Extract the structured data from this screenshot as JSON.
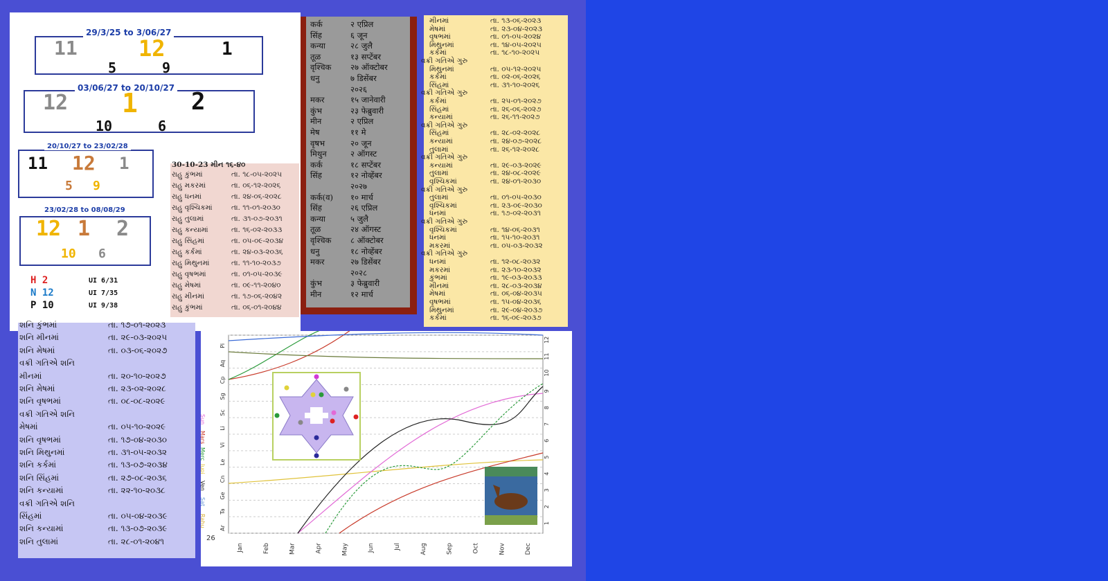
{
  "top_left": {
    "blocks": [
      {
        "caption": "29/3/25 to  3/06/27",
        "top": [
          "11",
          "12",
          "1"
        ],
        "bottom": [
          "5",
          "9"
        ]
      },
      {
        "caption": "03/06/27 to 20/10/27",
        "top": [
          "12",
          "1",
          "2"
        ],
        "bottom": [
          "10",
          "6"
        ]
      },
      {
        "caption": "20/10/27 to 23/02/28",
        "top": [
          "11",
          "12",
          "1"
        ],
        "bottom": [
          "5",
          "9"
        ]
      },
      {
        "caption": "23/02/28  to  08/08/29",
        "top": [
          "12",
          "1",
          "2"
        ],
        "bottom": [
          "10",
          "6"
        ]
      }
    ],
    "legend": [
      {
        "key": "H 2",
        "value": "UI 6/31"
      },
      {
        "key": "N 12",
        "value": "UI 7/35"
      },
      {
        "key": "P 10",
        "value": "UI 9/38"
      }
    ]
  },
  "hindi_list": {
    "rows": [
      [
        "कर्क",
        "२ एप्रिल"
      ],
      [
        "सिंह",
        "६ जून"
      ],
      [
        "कन्या",
        "२८ जुलै"
      ],
      [
        "तूळ",
        "१३ सप्टेंबर"
      ],
      [
        "वृश्चिक",
        "२७ ऑक्टोबर"
      ],
      [
        "धनु",
        "७ डिसेंबर"
      ],
      [
        "",
        "२०२६"
      ],
      [
        "मकर",
        "१५ जानेवारी"
      ],
      [
        "कुंभ",
        "२३ फेब्रुवारी"
      ],
      [
        "मीन",
        "२ एप्रिल"
      ],
      [
        "मेष",
        "११ मे"
      ],
      [
        "वृषभ",
        "२० जून"
      ],
      [
        "मिथुन",
        "२ ऑगस्ट"
      ],
      [
        "कर्क",
        "१८ सप्टेंबर"
      ],
      [
        "सिंह",
        "१२ नोव्हेंबर"
      ],
      [
        "",
        "२०२७"
      ],
      [
        "कर्क(व)",
        "१० मार्च"
      ],
      [
        "सिंह",
        "२६ एप्रिल"
      ],
      [
        "कन्या",
        "५ जुलै"
      ],
      [
        "तूळ",
        "२४ ऑगस्ट"
      ],
      [
        "वृश्चिक",
        "८ ऑक्टोबर"
      ],
      [
        "धनु",
        "१८ नोव्हेंबर"
      ],
      [
        "मकर",
        "२७ डिसेंबर"
      ],
      [
        "",
        "२०२८"
      ],
      [
        "कुंभ",
        "३ फेब्रुवारी"
      ],
      [
        "मीन",
        "१२ मार्च"
      ]
    ]
  },
  "pink_list": {
    "header": [
      "30-10-23",
      "મીન",
      "૧૬-૪૦"
    ],
    "rows": [
      [
        "રાહુ કુંભમાં",
        "તા. ૧૮-૦૫-૨૦૨૫"
      ],
      [
        "રાહુ મકરમાં",
        "તા. ૦૬-૧૨-૨૦૨૬"
      ],
      [
        "રાહુ ધનમાં",
        "તા. ૨૪-૦૬-૨૦૨૮"
      ],
      [
        "રાહુ વૃશ્ચિકમાં",
        "તા. ૧૧-૦૧-૨૦૩૦"
      ],
      [
        "રાહુ તુલામાં",
        "તા. ૩૧-૦૭-૨૦૩૧"
      ],
      [
        "રાહુ કન્યામાં",
        "તા. ૧૬-૦૨-૨૦૩૩"
      ],
      [
        "રાહુ સિંહમાં",
        "તા. ૦૫-૦૯-૨૦૩૪"
      ],
      [
        "રાહુ કર્કમાં",
        "તા. ૨૪-૦૩-૨૦૩૬"
      ],
      [
        "રાહુ મિથુનમાં",
        "તા. ૧૧-૧૦-૨૦૩૭"
      ],
      [
        "રાહુ વૃષભમાં",
        "તા. ૦૧-૦૫-૨૦૩૯"
      ],
      [
        "રાહુ મેષમાં",
        "તા. ૦૯-૧૧-૨૦૪૦"
      ],
      [
        "રાહુ મીનમાં",
        "તા. ૧૭-૦૬-૨૦૪૨"
      ],
      [
        "રાહુ કુંભમાં",
        "તા. ૦૬-૦૧-૨૦૪૪"
      ]
    ]
  },
  "yellow_list": {
    "rows": [
      [
        "મીનમાં",
        "તા. ૧૩-૦૬-૨૦૨૩"
      ],
      [
        "મેષમાં",
        "તા. ૨૩-૦૪-૨૦૨૩"
      ],
      [
        "વૃષભમાં",
        "તા. ૦૧-૦૫-૨૦૨૪"
      ],
      [
        "મિથુનમાં",
        "તા. ૧૪-૦૫-૨૦૨૫"
      ],
      [
        "કર્કમાં",
        "તા. ૧૮-૧૦-૨૦૨૫"
      ],
      [
        "વક્રી ગતિએ ગુરુ",
        ""
      ],
      [
        "મિથુનમાં",
        "તા. ૦૫-૧૨-૨૦૨૫"
      ],
      [
        "કર્કમાં",
        "તા. ૦૨-૦૬-૨૦૨૬"
      ],
      [
        "સિંહમાં",
        "તા. ૩૧-૧૦-૨૦૨૬"
      ],
      [
        "વક્રી ગતિએ ગુરુ",
        ""
      ],
      [
        "કર્કમાં",
        "તા. ૨૫-૦૧-૨૦૨૭"
      ],
      [
        "સિંહમાં",
        "તા. ૨૬-૦૬-૨૦૨૭"
      ],
      [
        "કન્યામાં",
        "તા. ૨૬-૧૧-૨૦૨૭"
      ],
      [
        "વક્રી ગતિએ ગુરુ",
        ""
      ],
      [
        "સિંહમાં",
        "તા. ૨૮-૦૨-૨૦૨૮"
      ],
      [
        "કન્યામાં",
        "તા. ૨૪-૦૭-૨૦૨૮"
      ],
      [
        "તુલામાં",
        "તા. ૨૬-૧૨-૨૦૨૮"
      ],
      [
        "વક્રી ગતિએ ગુરુ",
        ""
      ],
      [
        "કન્યામાં",
        "તા. ૨૯-૦૩-૨૦૨૯"
      ],
      [
        "તુલામાં",
        "તા. ૨૪-૦૮-૨૦૨૯"
      ],
      [
        "વૃશ્ચિકમાં",
        "તા. ૨૪-૦૧-૨૦૩૦"
      ],
      [
        "વક્રી ગતિએ ગુરુ",
        ""
      ],
      [
        "તુલામાં",
        "તા. ૦૧-૦૫-૨૦૩૦"
      ],
      [
        "વૃશ્ચિકમાં",
        "તા. ૨૩-૦૯-૨૦૩૦"
      ],
      [
        "ધનમાં",
        "તા. ૧૭-૦૨-૨૦૩૧"
      ],
      [
        "વક્રી ગતિએ ગુરુ",
        ""
      ],
      [
        "વૃશ્ચિકમાં",
        "તા. ૧૪-૦૬-૨૦૩૧"
      ],
      [
        "ધનમાં",
        "તા. ૧૫-૧૦-૨૦૩૧"
      ],
      [
        "મકરમાં",
        "તા. ૦૫-૦૩-૨૦૩૨"
      ],
      [
        "વક્રી ગતિએ ગુરુ",
        ""
      ],
      [
        "ધનમાં",
        "તા. ૧૨-૦૮-૨૦૩૨"
      ],
      [
        "મકરમાં",
        "તા. ૨૩-૧૦-૨૦૩૨"
      ],
      [
        "કુંભમાં",
        "તા. ૧૯-૦૩-૨૦૩૩"
      ],
      [
        "મીનમાં",
        "તા. ૨૮-૦૩-૨૦૩૪"
      ],
      [
        "મેષમાં",
        "તા. ૦૬-૦૪-૨૦૩૫"
      ],
      [
        "વૃષભમાં",
        "તા. ૧૫-૦૪-૨૦૩૬"
      ],
      [
        "મિથુનમાં",
        "તા. ૨૯-૦૪-૨૦૩૭"
      ],
      [
        "કર્કમાં",
        "તા. ૧૬-૦૯-૨૦૩૭"
      ]
    ]
  },
  "blue_list": {
    "rows": [
      [
        "શનિ  કુંભમાં",
        "તા. ૧૭-૦૧-૨૦૨૩"
      ],
      [
        "શનિ  મીનમાં",
        "તા. ૨૯-૦૩-૨૦૨૫"
      ],
      [
        "શનિ  મેષમાં",
        "તા. ૦૩-૦૬-૨૦૨૭"
      ],
      [
        "વક્રી ગતિએ શનિ",
        ""
      ],
      [
        "      મીનમાં",
        "તા. ૨૦-૧૦-૨૦૨૭"
      ],
      [
        "શનિ  મેષમાં",
        "તા. ૨૩-૦૨-૨૦૨૮"
      ],
      [
        "શનિ  વૃષભમાં",
        "તા. ૦૮-૦૮-૨૦૨૯"
      ],
      [
        "વક્રી ગતિએ શનિ",
        ""
      ],
      [
        "      મેષમાં",
        "તા. ૦૫-૧૦-૨૦૨૯"
      ],
      [
        "શનિ  વૃષભમાં",
        "તા. ૧૭-૦૪-૨૦૩૦"
      ],
      [
        "શનિ  મિથુનમાં",
        "તા. ૩૧-૦૫-૨૦૩૨"
      ],
      [
        "શનિ  કર્કમાં",
        "તા. ૧૩-૦૭-૨૦૩૪"
      ],
      [
        "શનિ સિંહમાં",
        "તા. ૨૭-૦૮-૨૦૩૬"
      ],
      [
        "શનિ  કન્યામાં",
        "તા. ૨૨-૧૦-૨૦૩૮"
      ],
      [
        "વક્રી ગતિએ શનિ",
        ""
      ],
      [
        "      સિંહમાં",
        "તા. ૦૫-૦૪-૨૦૩૯"
      ],
      [
        "શનિ  કન્યામાં",
        "તા. ૧૩-૦૭-૨૦૩૯"
      ],
      [
        "શનિ  તુલામાં",
        "તા. ૨૮-૦૧-૨૦૪૧"
      ]
    ]
  },
  "chart": {
    "months": [
      "Jan",
      "Feb",
      "Mar",
      "Apr",
      "May",
      "Jun",
      "Jul",
      "Aug",
      "Sep",
      "Oct",
      "Nov",
      "Dec"
    ],
    "left_signs": [
      "Pi",
      "Aq",
      "Cp",
      "Sg",
      "Sc",
      "Li",
      "Vi",
      "Le",
      "Cn",
      "Ge",
      "Ta",
      "Ar"
    ],
    "right_ticks": [
      "12",
      "11",
      "10",
      "9",
      "8",
      "7",
      "6",
      "5",
      "4",
      "3",
      "2",
      "1"
    ],
    "legend": [
      {
        "name": "Sun",
        "color": "#e26ad6"
      },
      {
        "name": "Mars",
        "color": "#c83a2a"
      },
      {
        "name": "Merc",
        "color": "#2a9a3a"
      },
      {
        "name": "Jupi",
        "color": "#e0c23a"
      },
      {
        "name": "Ven",
        "color": "#222"
      },
      {
        "name": "Sat",
        "color": "#6a9ad6"
      },
      {
        "name": "Rahu",
        "color": "#d8b03a"
      }
    ],
    "year_label": "26"
  }
}
